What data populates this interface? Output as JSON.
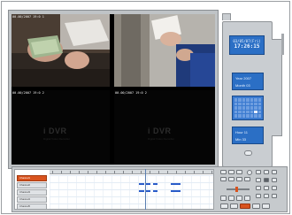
{
  "cameras": [
    {
      "label": "00.00/2007 19:0 1"
    },
    {
      "label": ""
    },
    {
      "label": "00.00/2007 19:0 2"
    },
    {
      "label": "00.00/2007 19:0 2"
    }
  ],
  "watermarks": [
    {
      "text": "i DVR",
      "sub": "Digital Video Recorder"
    },
    {
      "text": "i DVR",
      "sub": "Digital Video Recorder"
    }
  ],
  "clock": {
    "date": "03/05/07(Fri)",
    "time": "17:26:15"
  },
  "year_month": {
    "year_label": "Year",
    "year": "2007",
    "month_label": "Month",
    "month": "03"
  },
  "hour_min": {
    "hour_label": "Hour",
    "hour": "11",
    "min_label": "Min",
    "min": "33"
  },
  "timeline": {
    "channels": [
      "Channel1",
      "Channel2",
      "Channel3",
      "Channel4",
      "Channel5",
      "Channel6"
    ],
    "active_channel": 0
  },
  "colors": {
    "accent": "#d9531e",
    "panel": "#c9cdd1",
    "display_blue": "#2b6fc5",
    "record_blue": "#2a5cc9"
  }
}
